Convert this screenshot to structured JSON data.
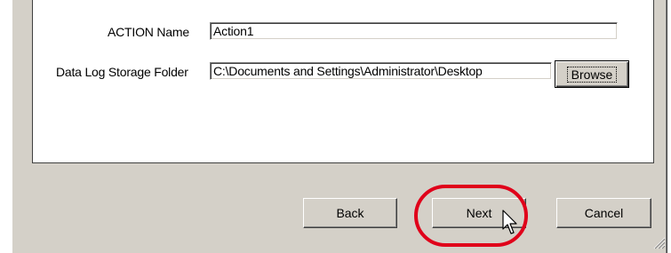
{
  "form": {
    "action_name_label": "ACTION Name",
    "action_name_value": "Action1",
    "folder_label": "Data Log Storage Folder",
    "folder_value": "C:\\Documents and Settings\\Administrator\\Desktop",
    "browse_label": "Browse"
  },
  "footer": {
    "back_label": "Back",
    "next_label": "Next",
    "cancel_label": "Cancel"
  },
  "annotation": {
    "highlight_color": "#e0001a"
  },
  "icons": [
    "resize-grip-icon",
    "mouse-pointer-icon"
  ]
}
